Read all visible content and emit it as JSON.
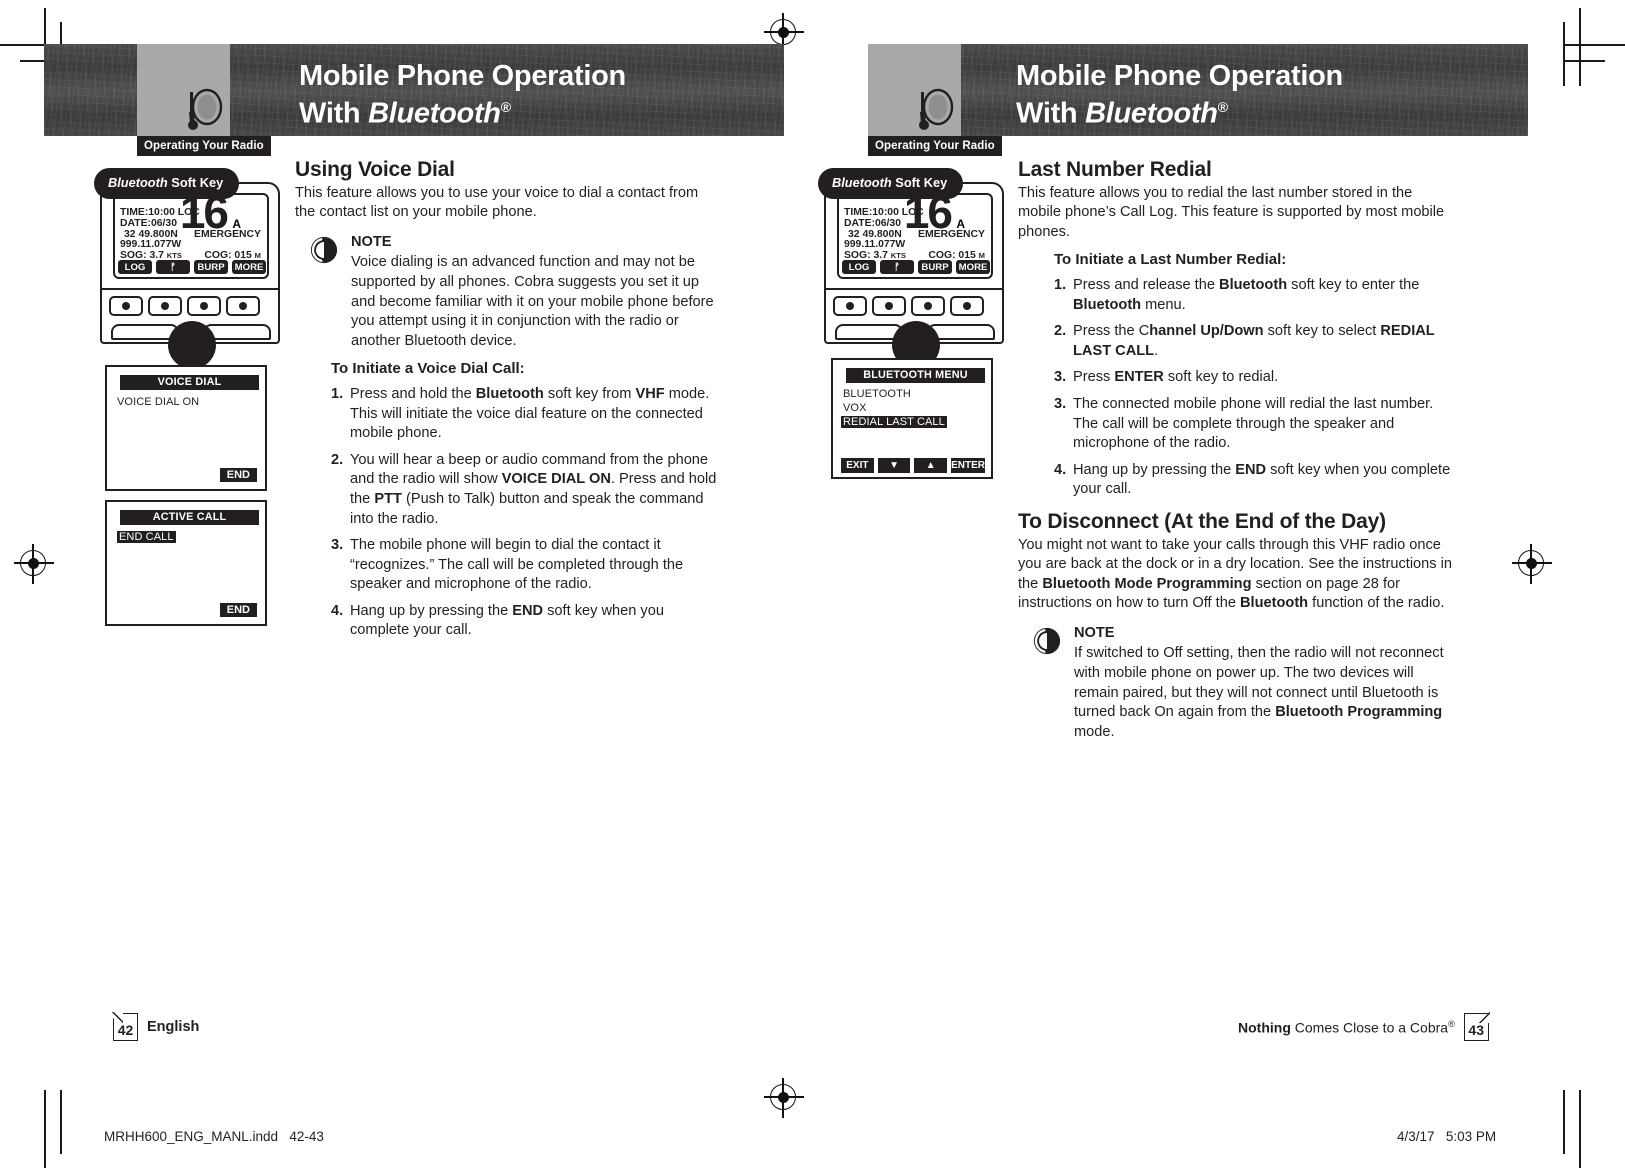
{
  "header": {
    "tab_label": "Operating Your Radio",
    "title_line1": "Mobile Phone Operation",
    "title_line2_prefix": "With ",
    "title_line2_italic": "Bluetooth",
    "title_registered": "®"
  },
  "radio_display": {
    "callout": "Soft Key",
    "callout_italic": "Bluetooth",
    "channel": "16",
    "channel_suffix": "A",
    "time": "TIME:10:00 LOC",
    "date": "DATE:06/30",
    "lat": "32 49.800N",
    "lon": "999.11.077W",
    "sog": "SOG: 3.7",
    "sog_unit": "KTS",
    "emergency": "EMERGENCY",
    "cog": "COG: 015",
    "cog_unit": "M",
    "softkeys": [
      "LOG",
      "BT",
      "BURP",
      "MORE"
    ]
  },
  "left_page": {
    "section_title": "Using Voice Dial",
    "intro": "This feature allows you to use your voice to dial a contact from the contact list on your mobile phone.",
    "note": {
      "title": "NOTE",
      "body": "Voice dialing is an advanced function and may not be supported by all phones. Cobra suggests you set it up and become familiar with it on your mobile phone before you attempt using it in conjunction with the radio or another Bluetooth device."
    },
    "steps_heading": "To Initiate a Voice Dial Call:",
    "steps": [
      {
        "num": "1.",
        "html": "Press and hold the <b>Bluetooth</b> soft key from <b>VHF</b> mode. This will initiate the voice dial feature on the connected mobile phone."
      },
      {
        "num": "2.",
        "html": "You will hear a beep or audio command from the phone and the radio will show <b>VOICE DIAL ON</b>. Press and hold the <b>PTT</b> (Push to Talk) button and speak the command into the radio."
      },
      {
        "num": "3.",
        "html": "The mobile phone will begin to dial the contact it “recognizes.” The call will be completed through the speaker and microphone of the radio."
      },
      {
        "num": "4.",
        "html": "Hang up by pressing the <b>END</b> soft key when you complete your call."
      }
    ],
    "screen_voice_dial": {
      "title": "VOICE DIAL",
      "item": "VOICE DIAL ON",
      "button": "END"
    },
    "screen_active_call": {
      "title": "ACTIVE CALL",
      "item": "END CALL",
      "button": "END"
    },
    "footer": {
      "page": "42",
      "label": "English"
    }
  },
  "right_page": {
    "section_title": "Last Number Redial",
    "intro": "This feature allows you to redial the last number stored in the mobile phone’s Call Log. This feature is supported by most mobile phones.",
    "steps_heading": "To Initiate a Last Number Redial:",
    "steps": [
      {
        "num": "1.",
        "html": "Press and release the <b>Bluetooth</b> soft key to enter the <b>Bluetooth</b> menu."
      },
      {
        "num": "2.",
        "html": "Press the C<b>hannel Up/Down</b> soft key to select <b>REDIAL LAST CALL</b>."
      },
      {
        "num": "3.",
        "html": "Press <b>ENTER</b> soft key to redial."
      },
      {
        "num": "3.",
        "html": "The connected mobile phone will redial the last number. The call will be complete through the speaker and microphone of the radio."
      },
      {
        "num": "4.",
        "html": "Hang up by pressing the <b>END</b> soft key when you complete your call."
      }
    ],
    "disconnect_title": "To Disconnect (At the End of the Day)",
    "disconnect_body": "You might not want to take your calls through this VHF radio once you are back at the dock or in a dry location. See the instructions in the <b>Bluetooth Mode Programming</b> section on page 28 for instructions on how to turn Off the <b>Bluetooth</b> function of the radio.",
    "note": {
      "title": "NOTE",
      "body": "If switched to Off setting, then the radio will not reconnect with mobile phone on power up. The two devices will remain paired, but they will not connect until Bluetooth is turned back On again from the <b>Bluetooth Programming</b> mode."
    },
    "screen_bt_menu": {
      "title": "BLUETOOTH MENU",
      "items": [
        "BLUETOOTH",
        "VOX",
        "REDIAL LAST CALL"
      ],
      "highlight_index": 2,
      "buttons": [
        "EXIT",
        "▼",
        "▲",
        "ENTER"
      ]
    },
    "footer": {
      "page": "43",
      "tagline_bold": "Nothing",
      "tagline_rest": " Comes Close to a Cobra",
      "tagline_sup": "®"
    }
  },
  "print_marks": {
    "file": "MRHH600_ENG_MANL.indd",
    "pages": "42-43",
    "date": "4/3/17",
    "time": "5:03 PM"
  },
  "colors": {
    "ink": "#231f20",
    "gray_box": "#a9a9a9",
    "band_dark": "#3f3f3f"
  }
}
